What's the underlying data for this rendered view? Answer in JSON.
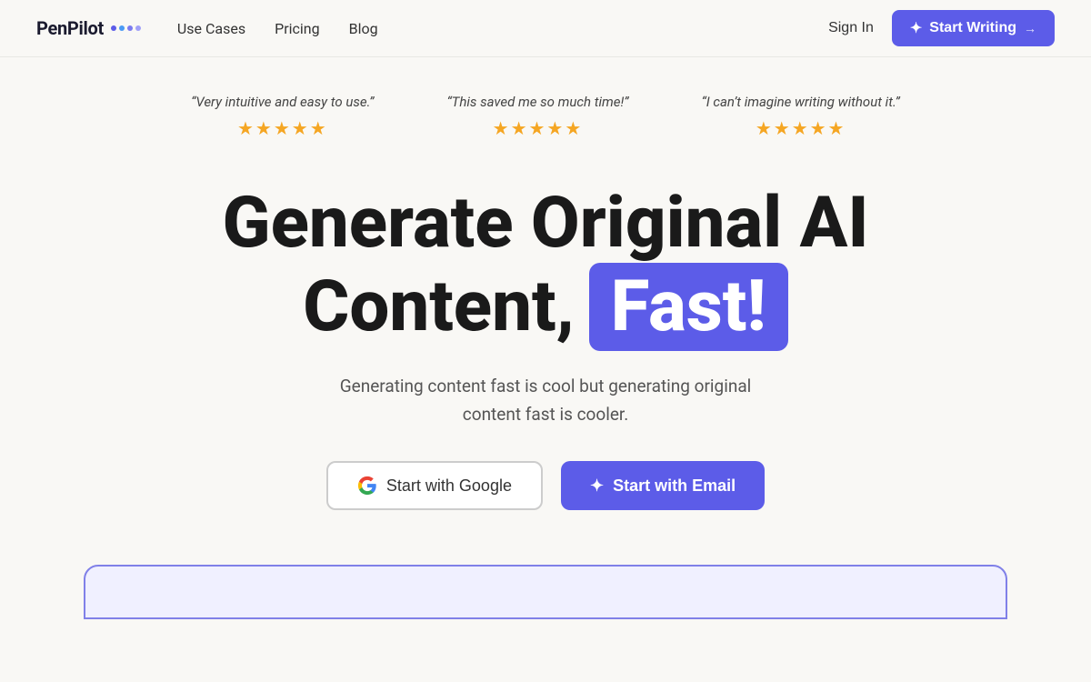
{
  "logo": {
    "text": "PenPilot",
    "dots": [
      "dot1",
      "dot2",
      "dot3",
      "dot4"
    ]
  },
  "nav": {
    "links": [
      {
        "label": "Use Cases",
        "href": "#"
      },
      {
        "label": "Pricing",
        "href": "#"
      },
      {
        "label": "Blog",
        "href": "#"
      }
    ],
    "sign_in": "Sign In",
    "start_writing": "Start Writing"
  },
  "testimonials": [
    {
      "text": "“Very intuitive and easy to use.”",
      "stars": "★★★★★"
    },
    {
      "text": "“This saved me so much time!”",
      "stars": "★★★★★"
    },
    {
      "text": "“I can’t imagine writing without it.”",
      "stars": "★★★★★"
    }
  ],
  "hero": {
    "title_line1": "Generate Original AI",
    "title_line2_prefix": "Content,",
    "title_fast": "Fast!",
    "subtitle": "Generating content fast is cool but generating original\ncontent fast is cooler."
  },
  "cta": {
    "google_label": "Start with Google",
    "email_label": "Start with Email"
  }
}
